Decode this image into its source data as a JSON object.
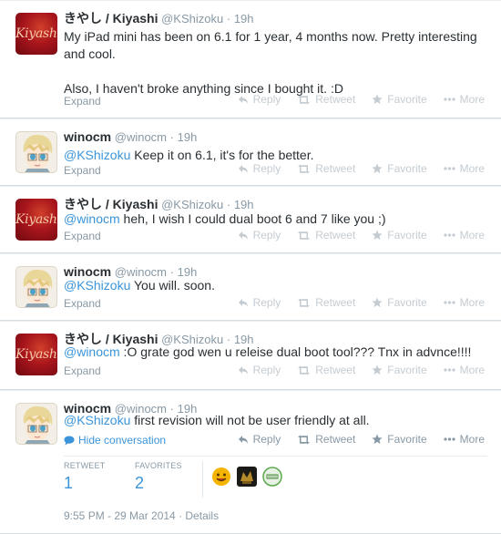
{
  "tweets": [
    {
      "fullname": "きやし / Kiyashi",
      "username": "@KShizoku",
      "time": "19h",
      "avatar_text": "Kiyashi",
      "paragraphs": [
        "My iPad mini has been on 6.1 for 1 year, 4 months now. Pretty interesting and cool.",
        "Also, I haven't broke anything since I bought it. :D"
      ]
    },
    {
      "fullname": "winocm",
      "username": "@winocm",
      "time": "19h",
      "mention": "@KShizoku",
      "text": " Keep it on 6.1, it's for the better."
    },
    {
      "fullname": "きやし / Kiyashi",
      "username": "@KShizoku",
      "time": "19h",
      "avatar_text": "Kiyashi",
      "mention": "@winocm",
      "text": " heh, I wish I could dual boot 6 and 7 like you ;)"
    },
    {
      "fullname": "winocm",
      "username": "@winocm",
      "time": "19h",
      "mention": "@KShizoku",
      "text": " You will. soon."
    },
    {
      "fullname": "きやし / Kiyashi",
      "username": "@KShizoku",
      "time": "19h",
      "avatar_text": "Kiyashi",
      "mention": "@winocm",
      "text": " :O grate god wen u releise dual boot tool??? Tnx in advnce!!!!"
    },
    {
      "fullname": "winocm",
      "username": "@winocm",
      "time": "19h",
      "mention": "@KShizoku",
      "text": " first revision will not be user friendly at all."
    }
  ],
  "labels": {
    "expand": "Expand",
    "hide_conversation": "Hide conversation",
    "reply": "Reply",
    "retweet": "Retweet",
    "favorite": "Favorite",
    "more": "More",
    "dot": "·"
  },
  "stats": {
    "retweets_label": "RETWEET",
    "retweets_count": "1",
    "favorites_label": "FAVORITES",
    "favorites_count": "2"
  },
  "timestamp": "9:55 PM - 29 Mar 2014 · Details",
  "colors": {
    "link": "#3b94d9",
    "muted": "#8899a6",
    "text": "#292f33"
  },
  "icons": [
    "reply-icon",
    "retweet-icon",
    "star-icon",
    "more-dots-icon",
    "speech-bubble-icon"
  ]
}
